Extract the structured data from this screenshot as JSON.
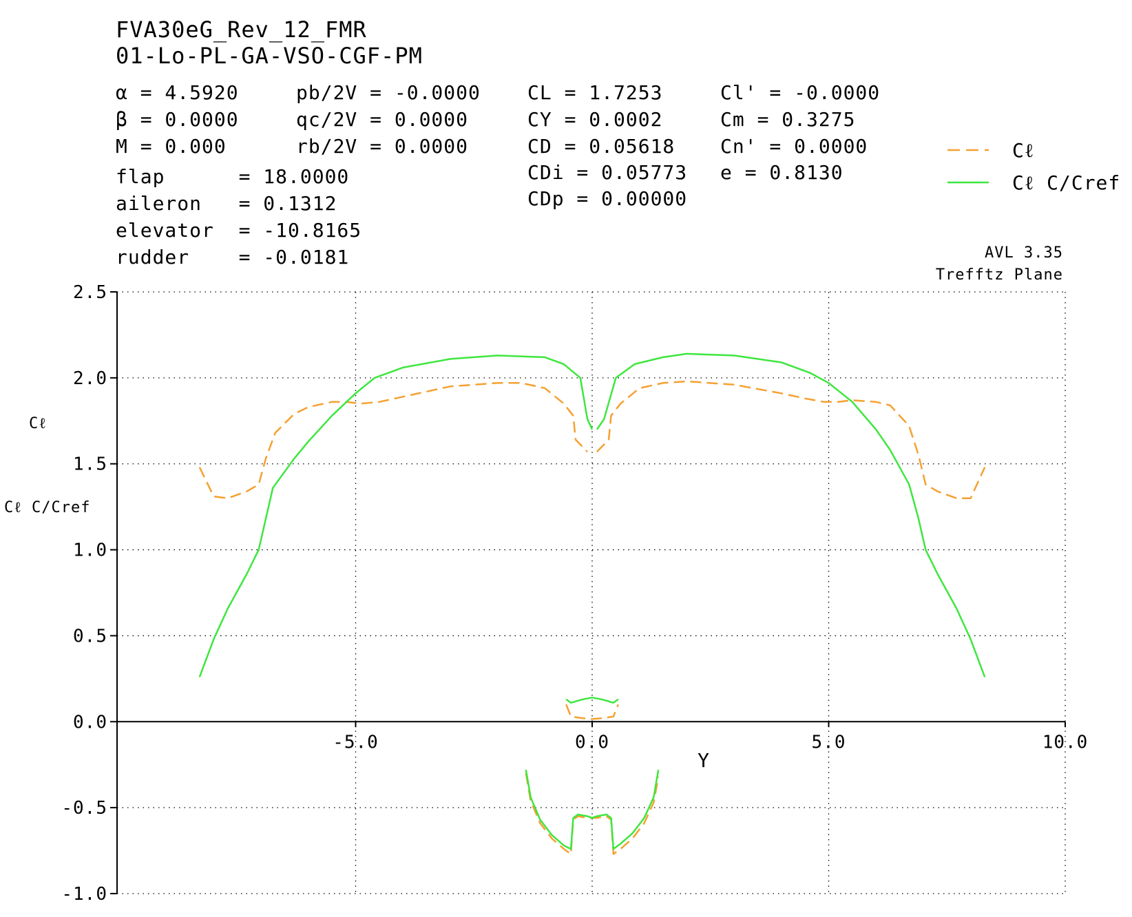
{
  "header": {
    "title_line1": "FVA30eG_Rev_12_FMR",
    "title_line2": "01-Lo-PL-GA-VSO-CGF-PM"
  },
  "params": {
    "col1": [
      "α = 4.5920",
      "β = 0.0000",
      "M = 0.000"
    ],
    "col2": [
      "pb/2V = -0.0000",
      "qc/2V = 0.0000",
      "rb/2V = 0.0000"
    ],
    "col3": [
      "CL = 1.7253",
      "CY = 0.0002",
      "CD = 0.05618",
      "CDi = 0.05773",
      "CDp = 0.00000"
    ],
    "col4": [
      "Cl' = -0.0000",
      "Cm = 0.3275",
      "Cn' = 0.0000",
      "e = 0.8130"
    ],
    "controls": [
      "flap      = 18.0000",
      "aileron   = 0.1312",
      "elevator  = -10.8165",
      "rudder    = -0.0181"
    ]
  },
  "program_info": {
    "version": "AVL 3.35",
    "plane": "Trefftz Plane"
  },
  "legend": {
    "cl": "Cℓ",
    "clc": "Cℓ C/Cref"
  },
  "colors": {
    "cl": "#f5a030",
    "clc": "#3ee63e",
    "axis": "#000000"
  },
  "chart_data": {
    "type": "line",
    "xlabel": "Y",
    "ylabel": [
      "Cℓ",
      "Cℓ C/Cref"
    ],
    "xlim": [
      -10.0,
      10.0
    ],
    "ylim": [
      -1.0,
      2.5
    ],
    "x_ticks": [
      "-5.0",
      "0.0",
      "5.0",
      "10.0"
    ],
    "y_ticks": [
      "2.5",
      "2.0",
      "1.5",
      "1.0",
      "0.5",
      "0.0",
      "-0.5",
      "-1.0"
    ],
    "grid": true,
    "legend_position": "top-right",
    "series": [
      {
        "name": "Cℓ",
        "style": "dashed",
        "segments": [
          [
            [
              -8.3,
              1.48
            ],
            [
              -8.0,
              1.31
            ],
            [
              -7.7,
              1.3
            ],
            [
              -7.3,
              1.34
            ],
            [
              -7.05,
              1.38
            ],
            [
              -6.9,
              1.53
            ],
            [
              -6.7,
              1.68
            ],
            [
              -6.3,
              1.79
            ],
            [
              -6.0,
              1.83
            ],
            [
              -5.5,
              1.86
            ],
            [
              -5.2,
              1.86
            ],
            [
              -4.9,
              1.85
            ],
            [
              -4.5,
              1.86
            ],
            [
              -4.0,
              1.89
            ],
            [
              -3.0,
              1.95
            ],
            [
              -2.0,
              1.97
            ],
            [
              -1.5,
              1.97
            ],
            [
              -1.0,
              1.94
            ],
            [
              -0.6,
              1.85
            ],
            [
              -0.4,
              1.78
            ],
            [
              -0.35,
              1.64
            ],
            [
              -0.1,
              1.57
            ]
          ],
          [
            [
              0.1,
              1.57
            ],
            [
              0.35,
              1.64
            ],
            [
              0.4,
              1.78
            ],
            [
              0.6,
              1.85
            ],
            [
              1.0,
              1.94
            ],
            [
              1.5,
              1.97
            ],
            [
              2.0,
              1.98
            ],
            [
              3.0,
              1.96
            ],
            [
              4.0,
              1.91
            ],
            [
              4.5,
              1.88
            ],
            [
              4.9,
              1.86
            ],
            [
              5.2,
              1.86
            ],
            [
              5.5,
              1.87
            ],
            [
              6.0,
              1.86
            ],
            [
              6.3,
              1.84
            ],
            [
              6.7,
              1.72
            ],
            [
              6.9,
              1.55
            ],
            [
              7.05,
              1.38
            ],
            [
              7.3,
              1.34
            ],
            [
              7.7,
              1.3
            ],
            [
              8.0,
              1.3
            ],
            [
              8.3,
              1.48
            ]
          ],
          [
            [
              -0.55,
              0.1
            ],
            [
              -0.45,
              0.03
            ],
            [
              -0.2,
              0.02
            ],
            [
              0.0,
              0.015
            ],
            [
              0.2,
              0.02
            ],
            [
              0.45,
              0.03
            ],
            [
              0.55,
              0.1
            ]
          ],
          [
            [
              -1.4,
              -0.3
            ],
            [
              -1.3,
              -0.46
            ],
            [
              -1.1,
              -0.59
            ],
            [
              -0.85,
              -0.68
            ],
            [
              -0.6,
              -0.74
            ],
            [
              -0.45,
              -0.77
            ],
            [
              -0.4,
              -0.57
            ],
            [
              -0.3,
              -0.55
            ],
            [
              -0.1,
              -0.56
            ],
            [
              0.0,
              -0.56
            ],
            [
              0.1,
              -0.56
            ],
            [
              0.3,
              -0.55
            ],
            [
              0.4,
              -0.57
            ],
            [
              0.45,
              -0.77
            ],
            [
              0.6,
              -0.74
            ],
            [
              0.85,
              -0.68
            ],
            [
              1.1,
              -0.59
            ],
            [
              1.3,
              -0.47
            ],
            [
              1.4,
              -0.32
            ]
          ]
        ]
      },
      {
        "name": "Cℓ C/Cref",
        "style": "solid",
        "segments": [
          [
            [
              -8.3,
              0.26
            ],
            [
              -8.0,
              0.48
            ],
            [
              -7.7,
              0.66
            ],
            [
              -7.3,
              0.86
            ],
            [
              -7.05,
              1.0
            ],
            [
              -6.9,
              1.18
            ],
            [
              -6.75,
              1.36
            ],
            [
              -6.3,
              1.53
            ],
            [
              -6.0,
              1.63
            ],
            [
              -5.5,
              1.78
            ],
            [
              -5.0,
              1.91
            ],
            [
              -4.6,
              2.0
            ],
            [
              -4.0,
              2.06
            ],
            [
              -3.0,
              2.11
            ],
            [
              -2.0,
              2.13
            ],
            [
              -1.0,
              2.12
            ],
            [
              -0.6,
              2.08
            ],
            [
              -0.25,
              2.0
            ],
            [
              -0.1,
              1.76
            ],
            [
              0.0,
              1.7
            ]
          ],
          [
            [
              0.1,
              1.7
            ],
            [
              0.25,
              1.76
            ],
            [
              0.5,
              2.0
            ],
            [
              0.9,
              2.08
            ],
            [
              1.5,
              2.12
            ],
            [
              2.0,
              2.14
            ],
            [
              3.0,
              2.13
            ],
            [
              4.0,
              2.09
            ],
            [
              4.6,
              2.03
            ],
            [
              5.0,
              1.97
            ],
            [
              5.5,
              1.86
            ],
            [
              6.0,
              1.7
            ],
            [
              6.3,
              1.58
            ],
            [
              6.7,
              1.38
            ],
            [
              6.9,
              1.18
            ],
            [
              7.05,
              1.0
            ],
            [
              7.3,
              0.86
            ],
            [
              7.7,
              0.66
            ],
            [
              8.0,
              0.48
            ],
            [
              8.3,
              0.26
            ]
          ],
          [
            [
              -0.55,
              0.13
            ],
            [
              -0.45,
              0.11
            ],
            [
              -0.2,
              0.13
            ],
            [
              0.0,
              0.14
            ],
            [
              0.2,
              0.13
            ],
            [
              0.45,
              0.11
            ],
            [
              0.55,
              0.13
            ]
          ],
          [
            [
              -1.4,
              -0.28
            ],
            [
              -1.3,
              -0.44
            ],
            [
              -1.1,
              -0.57
            ],
            [
              -0.85,
              -0.66
            ],
            [
              -0.6,
              -0.72
            ],
            [
              -0.45,
              -0.74
            ],
            [
              -0.4,
              -0.56
            ],
            [
              -0.3,
              -0.54
            ],
            [
              -0.1,
              -0.55
            ],
            [
              0.0,
              -0.56
            ],
            [
              0.1,
              -0.55
            ],
            [
              0.3,
              -0.54
            ],
            [
              0.4,
              -0.56
            ],
            [
              0.45,
              -0.74
            ],
            [
              0.6,
              -0.71
            ],
            [
              0.85,
              -0.65
            ],
            [
              1.1,
              -0.56
            ],
            [
              1.3,
              -0.44
            ],
            [
              1.4,
              -0.28
            ]
          ]
        ]
      }
    ]
  }
}
